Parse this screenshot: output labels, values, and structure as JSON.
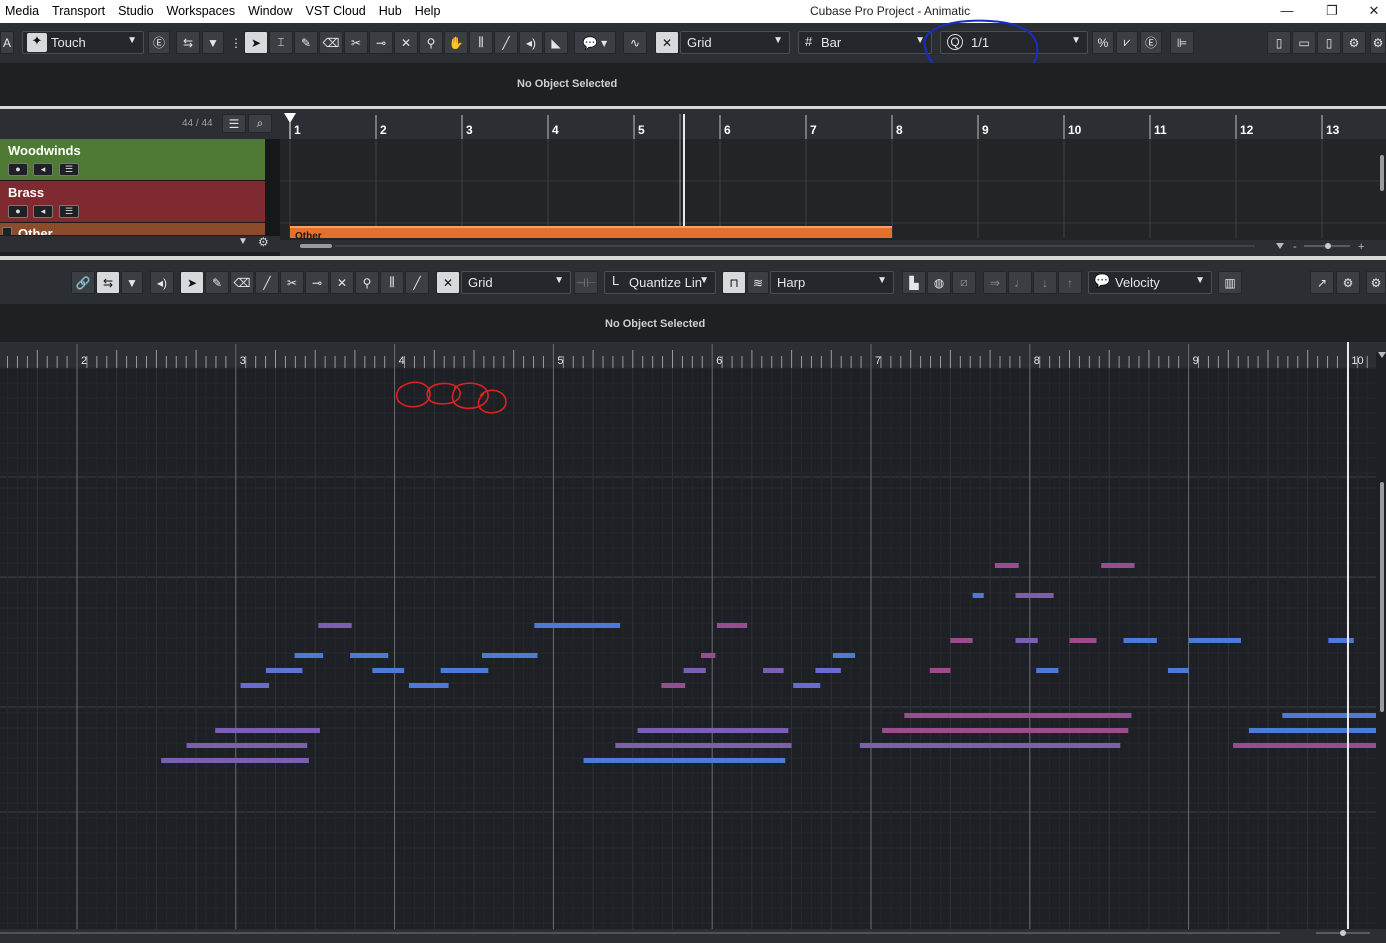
{
  "menubar": {
    "items": [
      "Media",
      "Transport",
      "Studio",
      "Workspaces",
      "Window",
      "VST Cloud",
      "Hub",
      "Help"
    ],
    "title": "Cubase Pro Project - Animatic",
    "controls": [
      "—",
      "❐",
      "✕"
    ]
  },
  "project_toolbar": {
    "left_label": "A",
    "automation_mode": "Touch",
    "snap_type": "Grid",
    "grid_type": "Bar",
    "quantize": "1/1"
  },
  "project_info": {
    "text": "No Object Selected"
  },
  "track_list": {
    "count": "44 / 44",
    "tracks": [
      {
        "name": "Woodwinds",
        "color": "#4e7a34"
      },
      {
        "name": "Brass",
        "color": "#7f2a30"
      },
      {
        "name": "Other",
        "color": "#8a4c2a"
      }
    ]
  },
  "project_ruler": {
    "bars": [
      "1",
      "2",
      "3",
      "4",
      "5",
      "6",
      "7",
      "8",
      "9",
      "10",
      "11",
      "12",
      "13"
    ]
  },
  "event": {
    "label": "Other",
    "color": "#e3712b"
  },
  "editor_toolbar": {
    "snap_type": "Grid",
    "quantize_length": "Quantize Lin",
    "instrument": "Harp",
    "controller_lane": "Velocity"
  },
  "editor_info": {
    "text": "No Object Selected"
  },
  "editor_ruler": {
    "bars": [
      "2",
      "3",
      "4",
      "5",
      "6",
      "7",
      "8",
      "9",
      "10"
    ]
  },
  "notes": [
    {
      "bar": 2.53,
      "len": 0.93,
      "pitch": 0,
      "color": "#7b5fb0"
    },
    {
      "bar": 2.69,
      "len": 0.76,
      "pitch": 1,
      "color": "#7b5fb0"
    },
    {
      "bar": 2.87,
      "len": 0.66,
      "pitch": 2,
      "color": "#7b5fb0"
    },
    {
      "bar": 3.03,
      "len": 0.18,
      "pitch": 5,
      "color": "#6a6bd0"
    },
    {
      "bar": 3.19,
      "len": 0.23,
      "pitch": 6,
      "color": "#5b75d0"
    },
    {
      "bar": 3.37,
      "len": 0.18,
      "pitch": 7,
      "color": "#4d7ad6"
    },
    {
      "bar": 3.52,
      "len": 0.21,
      "pitch": 9,
      "color": "#7b5fb0"
    },
    {
      "bar": 3.72,
      "len": 0.24,
      "pitch": 7,
      "color": "#4d7ad6"
    },
    {
      "bar": 3.86,
      "len": 0.2,
      "pitch": 6,
      "color": "#4d7ad6"
    },
    {
      "bar": 4.09,
      "len": 0.25,
      "pitch": 5,
      "color": "#4d7ad6"
    },
    {
      "bar": 4.29,
      "len": 0.3,
      "pitch": 6,
      "color": "#4d7ad6"
    },
    {
      "bar": 4.55,
      "len": 0.35,
      "pitch": 7,
      "color": "#4d7ad6"
    },
    {
      "bar": 4.88,
      "len": 0.54,
      "pitch": 9,
      "color": "#4d7ad6"
    },
    {
      "bar": 5.19,
      "len": 1.27,
      "pitch": 0,
      "color": "#4d7ad6"
    },
    {
      "bar": 5.39,
      "len": 1.11,
      "pitch": 1,
      "color": "#7b5fb0"
    },
    {
      "bar": 5.53,
      "len": 0.95,
      "pitch": 2,
      "color": "#7b5fb0"
    },
    {
      "bar": 5.68,
      "len": 0.15,
      "pitch": 5,
      "color": "#9a4d8e"
    },
    {
      "bar": 5.82,
      "len": 0.14,
      "pitch": 6,
      "color": "#7b5fb0"
    },
    {
      "bar": 5.93,
      "len": 0.09,
      "pitch": 7,
      "color": "#9a4d8e"
    },
    {
      "bar": 6.03,
      "len": 0.19,
      "pitch": 9,
      "color": "#9a4d8e"
    },
    {
      "bar": 6.32,
      "len": 0.13,
      "pitch": 6,
      "color": "#7b5fb0"
    },
    {
      "bar": 6.51,
      "len": 0.17,
      "pitch": 5,
      "color": "#6a6bd0"
    },
    {
      "bar": 6.65,
      "len": 0.16,
      "pitch": 6,
      "color": "#6a6bd0"
    },
    {
      "bar": 6.76,
      "len": 0.14,
      "pitch": 7,
      "color": "#4d7ad6"
    },
    {
      "bar": 6.93,
      "len": 1.64,
      "pitch": 1,
      "color": "#7b5fb0"
    },
    {
      "bar": 7.07,
      "len": 1.55,
      "pitch": 2,
      "color": "#9a4d8e"
    },
    {
      "bar": 7.21,
      "len": 1.43,
      "pitch": 3,
      "color": "#9a4d8e"
    },
    {
      "bar": 7.37,
      "len": 0.13,
      "pitch": 6,
      "color": "#9a4d8e"
    },
    {
      "bar": 7.5,
      "len": 0.14,
      "pitch": 8,
      "color": "#9a4d8e"
    },
    {
      "bar": 7.64,
      "len": 0.07,
      "pitch": 11,
      "color": "#4d7ad6"
    },
    {
      "bar": 7.78,
      "len": 0.15,
      "pitch": 13,
      "color": "#9a4d8e"
    },
    {
      "bar": 7.91,
      "len": 0.24,
      "pitch": 11,
      "color": "#7b5fb0"
    },
    {
      "bar": 7.91,
      "len": 0.14,
      "pitch": 8,
      "color": "#7b5fb0"
    },
    {
      "bar": 8.04,
      "len": 0.14,
      "pitch": 6,
      "color": "#4d7ad6"
    },
    {
      "bar": 8.25,
      "len": 0.17,
      "pitch": 8,
      "color": "#9a4d8e"
    },
    {
      "bar": 8.45,
      "len": 0.21,
      "pitch": 13,
      "color": "#9a4d8e"
    },
    {
      "bar": 8.59,
      "len": 0.21,
      "pitch": 8,
      "color": "#4d7ad6"
    },
    {
      "bar": 8.87,
      "len": 0.13,
      "pitch": 6,
      "color": "#4d7ad6"
    },
    {
      "bar": 9.0,
      "len": 0.33,
      "pitch": 8,
      "color": "#4d7ad6"
    },
    {
      "bar": 9.28,
      "len": 0.91,
      "pitch": 1,
      "color": "#9a4d8e"
    },
    {
      "bar": 9.38,
      "len": 0.81,
      "pitch": 2,
      "color": "#4d7ad6"
    },
    {
      "bar": 9.59,
      "len": 0.6,
      "pitch": 3,
      "color": "#4d7ad6"
    },
    {
      "bar": 9.88,
      "len": 0.16,
      "pitch": 8,
      "color": "#4d7ad6"
    }
  ]
}
